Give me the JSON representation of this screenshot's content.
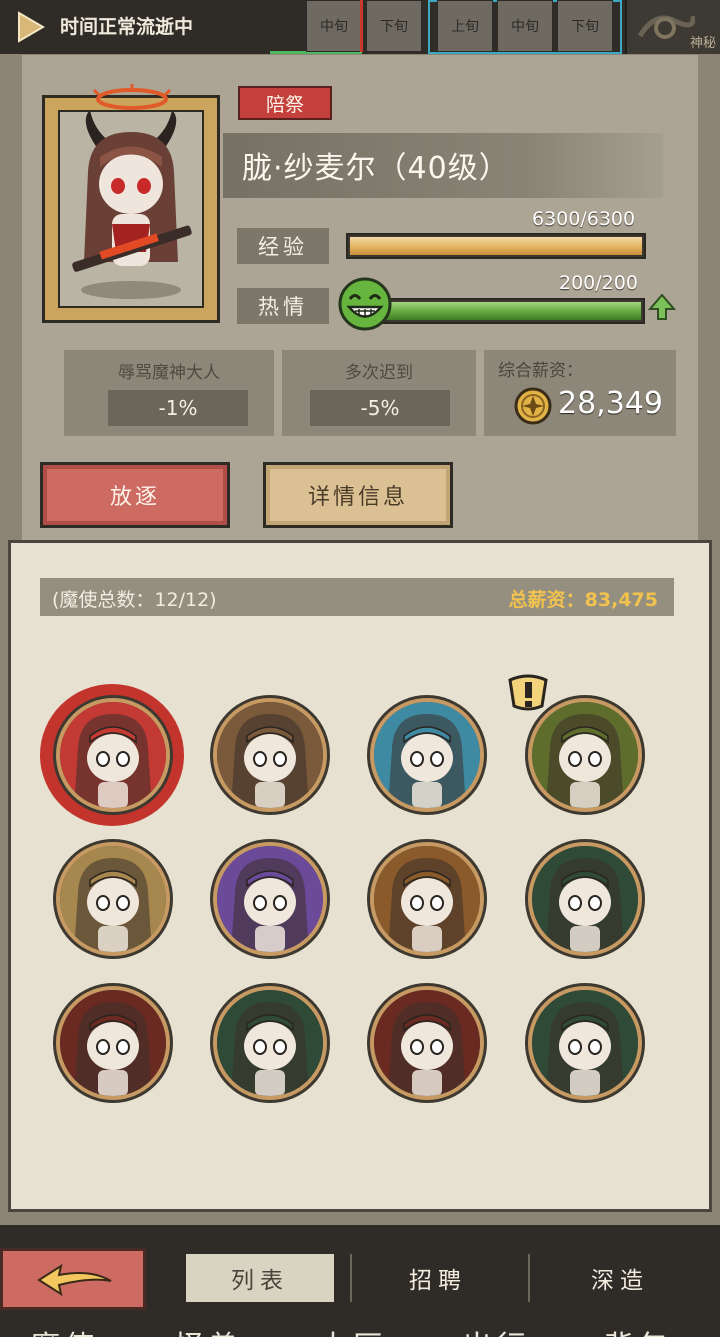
{
  "top_bar": {
    "time_status": "时间正常流逝中",
    "month_left": [
      "中旬",
      "下旬"
    ],
    "month_right": [
      "上旬",
      "中旬",
      "下旬"
    ],
    "map_label": "神秘"
  },
  "character": {
    "role_badge": "陪祭",
    "name": "胧·纱麦尔（40级）",
    "exp": {
      "label": "经验",
      "text": "6300/6300",
      "fraction": 1.0
    },
    "passion": {
      "label": "热情",
      "text": "200/200",
      "fraction": 1.0
    },
    "traits": [
      {
        "name": "辱骂魔神大人",
        "value": "-1%"
      },
      {
        "name": "多次迟到",
        "value": "-5%"
      }
    ],
    "salary_label": "综合薪资：",
    "salary_value": "28,349"
  },
  "actions": {
    "exile": "放逐",
    "details": "详情信息"
  },
  "roster": {
    "count_text": "(魔使总数：12/12)",
    "total_salary_text": "总薪资：83,475",
    "avatars": [
      {
        "name": "avatar-1",
        "selected": true,
        "palette": "#c23a33"
      },
      {
        "name": "avatar-2",
        "palette": "#7a5a3a"
      },
      {
        "name": "avatar-3",
        "palette": "#3e8aa3"
      },
      {
        "name": "avatar-4",
        "palette": "#5f6d2c",
        "alert": true
      },
      {
        "name": "avatar-5",
        "palette": "#a6874d"
      },
      {
        "name": "avatar-6",
        "palette": "#6c4a9a"
      },
      {
        "name": "avatar-7",
        "palette": "#8a5a2a"
      },
      {
        "name": "avatar-8",
        "palette": "#2f4a36"
      },
      {
        "name": "avatar-9",
        "palette": "#6a2a22"
      },
      {
        "name": "avatar-10",
        "palette": "#2f4a36"
      },
      {
        "name": "avatar-11",
        "palette": "#6a2a22"
      },
      {
        "name": "avatar-12",
        "palette": "#2f4a36"
      }
    ]
  },
  "bottom": {
    "tabs": [
      "列表",
      "招聘",
      "深造"
    ],
    "nav": [
      "魔使",
      "怪兽",
      "大厅",
      "出行",
      "背包"
    ]
  },
  "colors": {
    "accent_red": "#cd6a62",
    "exp_bar": "#e6b869",
    "passion_bar": "#5ea43a",
    "gold_text": "#f1c24e"
  }
}
